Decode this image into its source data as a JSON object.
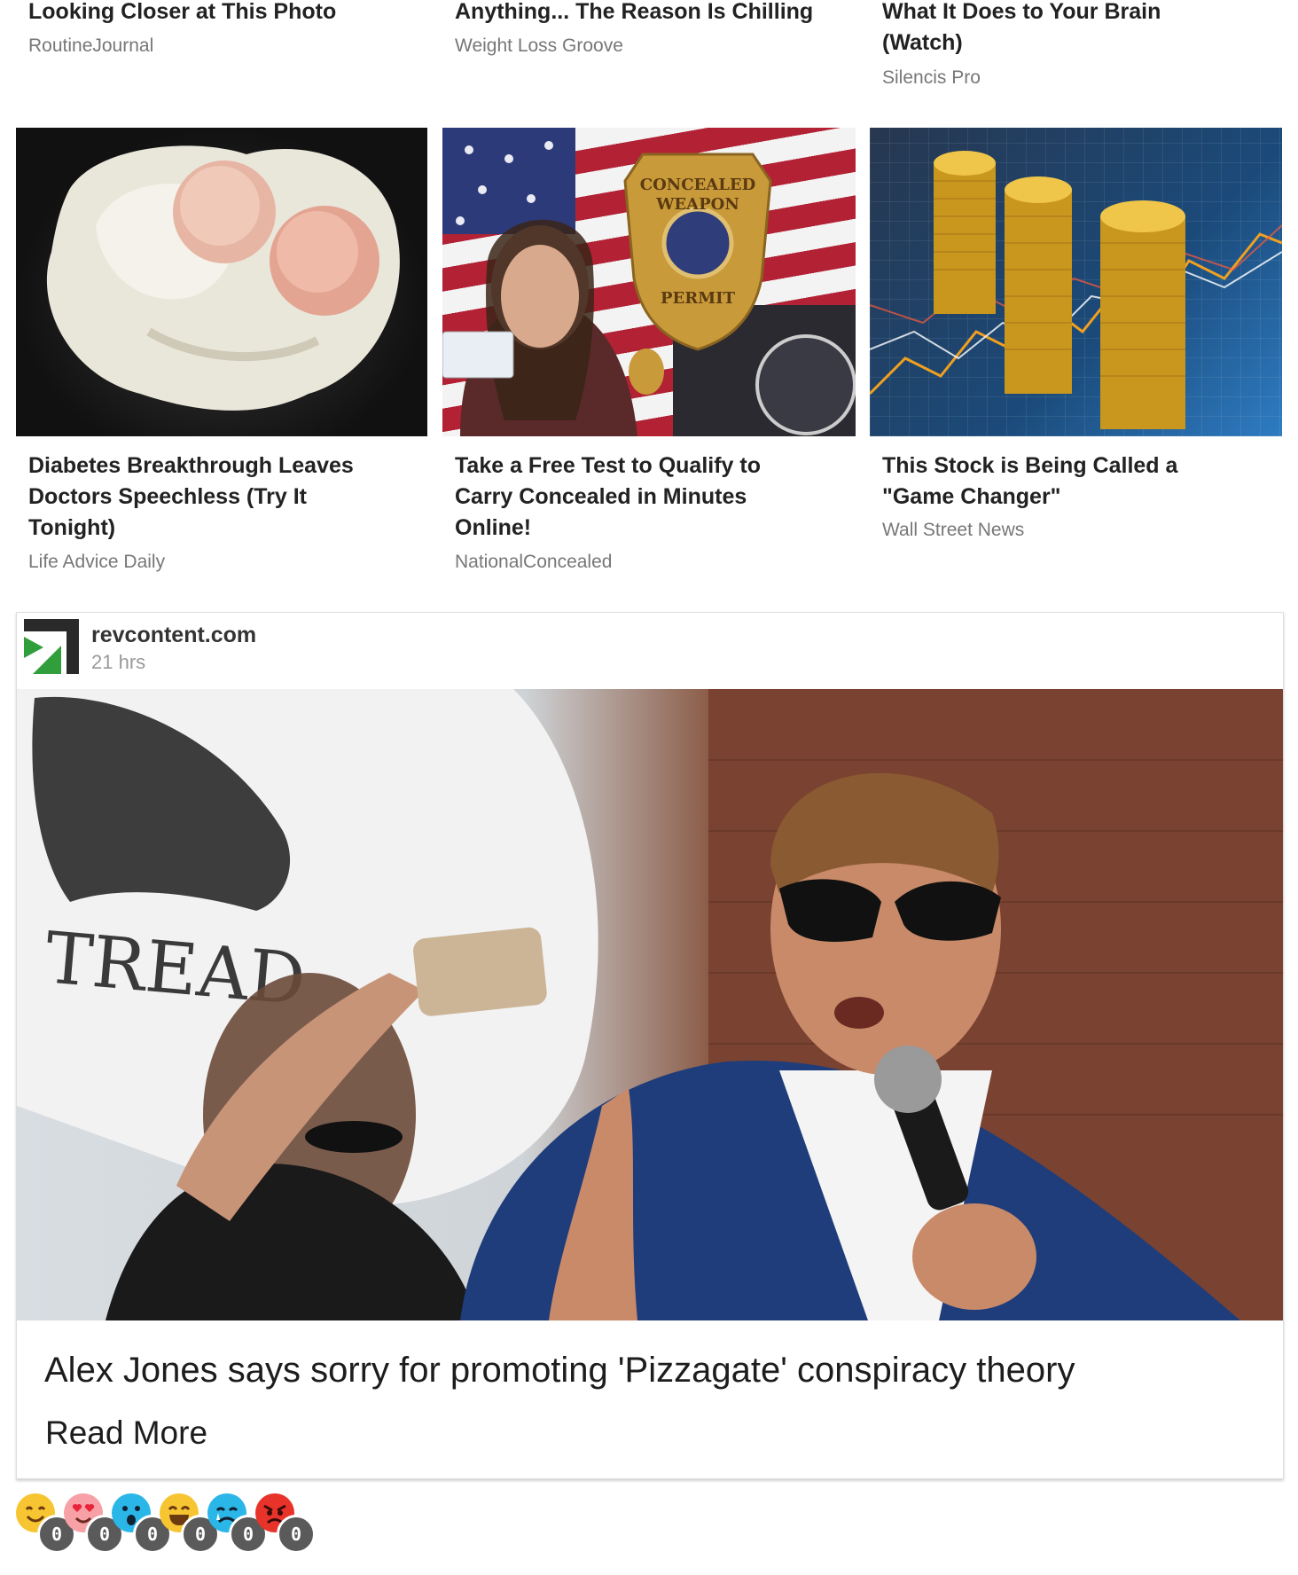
{
  "top_row": [
    {
      "title": "Looking Closer at This Photo",
      "source": "RoutineJournal"
    },
    {
      "title": "Anything... The Reason Is Chilling",
      "source": "Weight Loss Groove"
    },
    {
      "title_lines": [
        "What It Does to Your Brain",
        "(Watch)"
      ],
      "source": "Silencis Pro"
    }
  ],
  "middle_row": [
    {
      "title_lines": [
        "Diabetes Breakthrough Leaves",
        "Doctors Speechless (Try It",
        "Tonight)"
      ],
      "source": "Life Advice Daily"
    },
    {
      "title_lines": [
        "Take a Free Test to Qualify to",
        "Carry Concealed in Minutes",
        "Online!"
      ],
      "source": "NationalConcealed",
      "badge_top": "CONCEALED",
      "badge_mid": "WEAPON",
      "badge_bottom": "PERMIT"
    },
    {
      "title_lines": [
        "This Stock is Being Called a",
        "\"Game Changer\""
      ],
      "source": "Wall Street News"
    }
  ],
  "post": {
    "publisher": "revcontent.com",
    "time": "21 hrs",
    "hero_sign_text": "TREAD",
    "headline": "Alex Jones says sorry for promoting 'Pizzagate' conspiracy theory",
    "read_more": "Read More"
  },
  "reactions": [
    {
      "name": "smile",
      "count": "0",
      "color": "#f7c531"
    },
    {
      "name": "love",
      "count": "0",
      "color": "#f7a0a6"
    },
    {
      "name": "surprised",
      "count": "0",
      "color": "#2bb6e8"
    },
    {
      "name": "laugh",
      "count": "0",
      "color": "#f7c531"
    },
    {
      "name": "sad",
      "count": "0",
      "color": "#2bb6e8"
    },
    {
      "name": "angry",
      "count": "0",
      "color": "#e8332a"
    }
  ]
}
